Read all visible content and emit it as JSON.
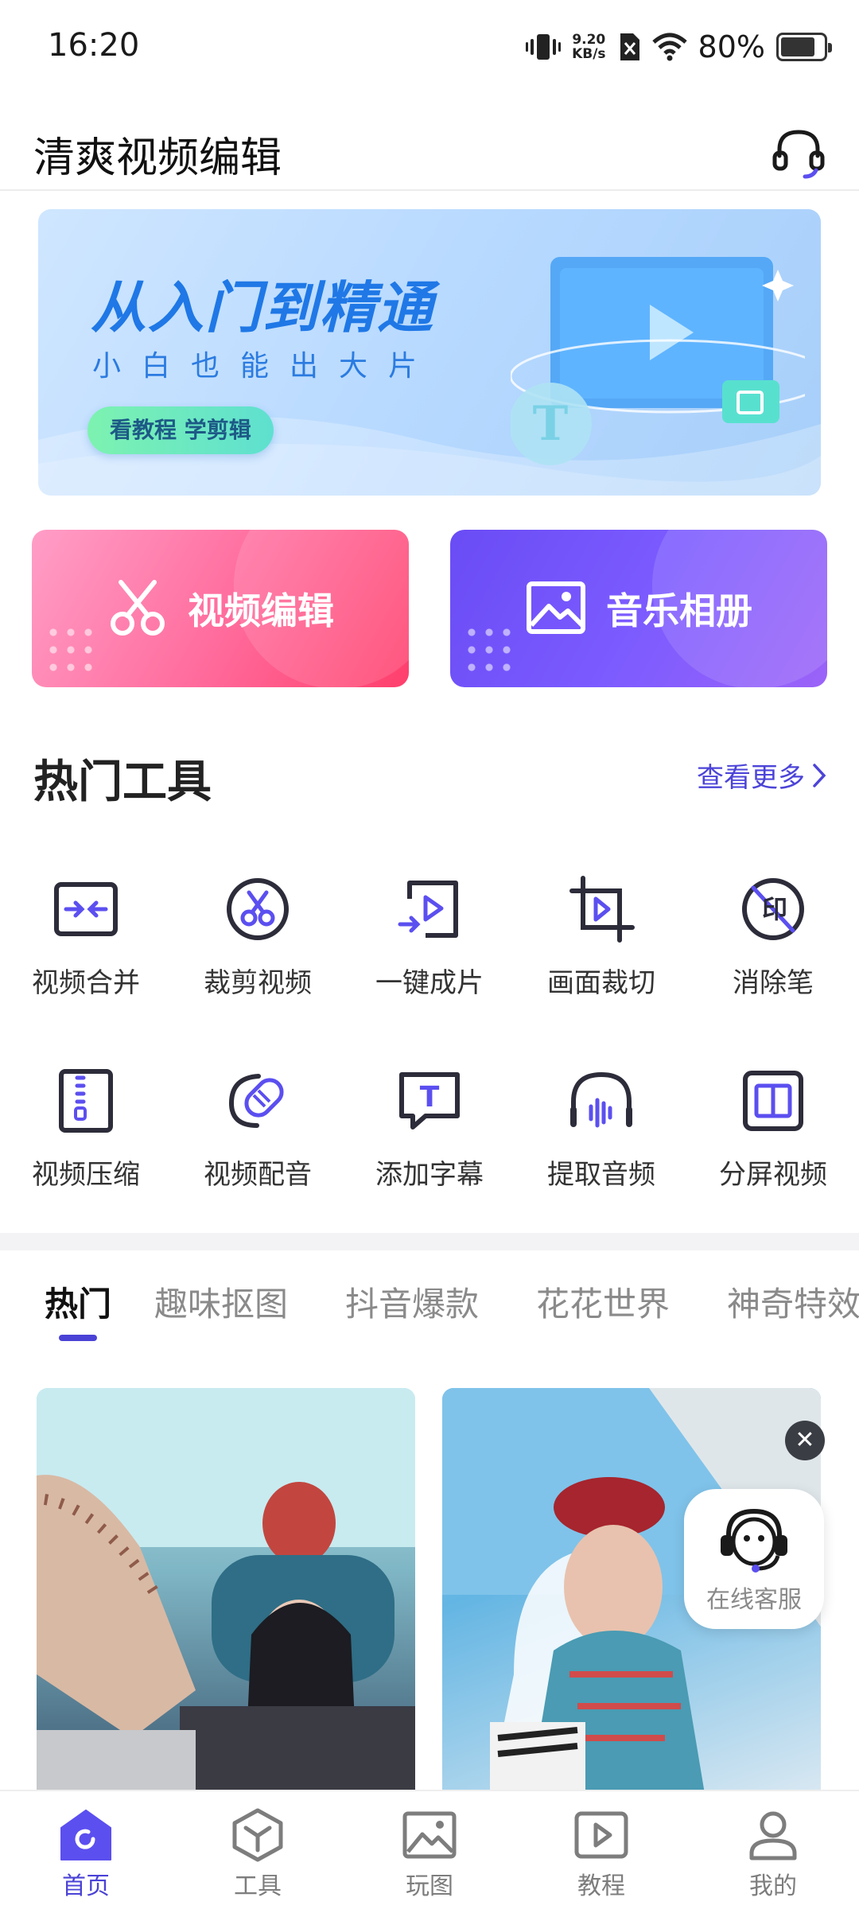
{
  "status_bar": {
    "time": "16:20",
    "net_speed_value": "9.20",
    "net_speed_unit": "KB/s",
    "battery_text": "80%",
    "battery_level": 0.8
  },
  "header": {
    "title": "清爽视频编辑"
  },
  "banner": {
    "title": "从入门到精通",
    "subtitle": "小白也能出大片",
    "cta_label": "看教程 学剪辑",
    "art_letter": "T"
  },
  "features": [
    {
      "label": "视频编辑",
      "icon": "scissors-icon"
    },
    {
      "label": "音乐相册",
      "icon": "image-icon"
    }
  ],
  "hot_tools": {
    "title": "热门工具",
    "more_label": "查看更多",
    "items": [
      {
        "label": "视频合并",
        "icon": "merge-icon"
      },
      {
        "label": "裁剪视频",
        "icon": "cut-video-icon"
      },
      {
        "label": "一键成片",
        "icon": "one-click-icon"
      },
      {
        "label": "画面裁切",
        "icon": "crop-icon"
      },
      {
        "label": "消除笔",
        "icon": "eraser-icon",
        "glyph": "印"
      },
      {
        "label": "视频压缩",
        "icon": "compress-icon"
      },
      {
        "label": "视频配音",
        "icon": "dubbing-icon"
      },
      {
        "label": "添加字幕",
        "icon": "subtitle-icon",
        "glyph": "T"
      },
      {
        "label": "提取音频",
        "icon": "audio-extract-icon"
      },
      {
        "label": "分屏视频",
        "icon": "split-screen-icon"
      }
    ]
  },
  "category_tabs": [
    {
      "label": "热门",
      "active": true
    },
    {
      "label": "趣味抠图",
      "active": false
    },
    {
      "label": "抖音爆款",
      "active": false
    },
    {
      "label": "花花世界",
      "active": false
    },
    {
      "label": "神奇特效",
      "active": false
    }
  ],
  "floating_support": {
    "close_glyph": "✕",
    "label": "在线客服"
  },
  "bottom_nav": [
    {
      "label": "首页",
      "icon": "home-icon",
      "active": true
    },
    {
      "label": "工具",
      "icon": "tools-icon",
      "active": false
    },
    {
      "label": "玩图",
      "icon": "picture-icon",
      "active": false
    },
    {
      "label": "教程",
      "icon": "tutorial-icon",
      "active": false
    },
    {
      "label": "我的",
      "icon": "profile-icon",
      "active": false
    }
  ],
  "colors": {
    "accent": "#4a42d6",
    "tool_icon": "#2c2c3a",
    "tool_icon_accent": "#5b4ff0",
    "video_card": "#ff5a86",
    "music_card": "#6f52f8"
  }
}
